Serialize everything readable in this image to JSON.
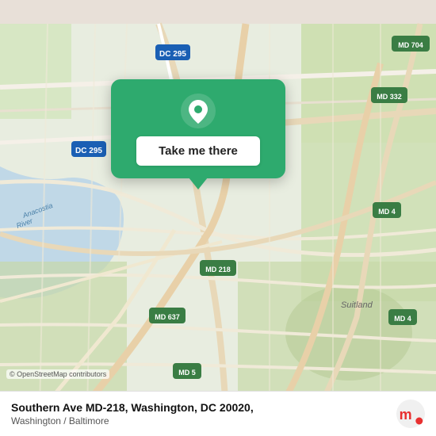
{
  "map": {
    "background_color": "#e8e0d8",
    "osm_credit": "© OpenStreetMap contributors"
  },
  "popup": {
    "button_label": "Take me there",
    "accent_color": "#2eaa6e"
  },
  "bottom_bar": {
    "location_title": "Southern Ave MD-218, Washington, DC 20020,",
    "location_subtitle": "Washington / Baltimore",
    "logo_text": "moovit"
  }
}
